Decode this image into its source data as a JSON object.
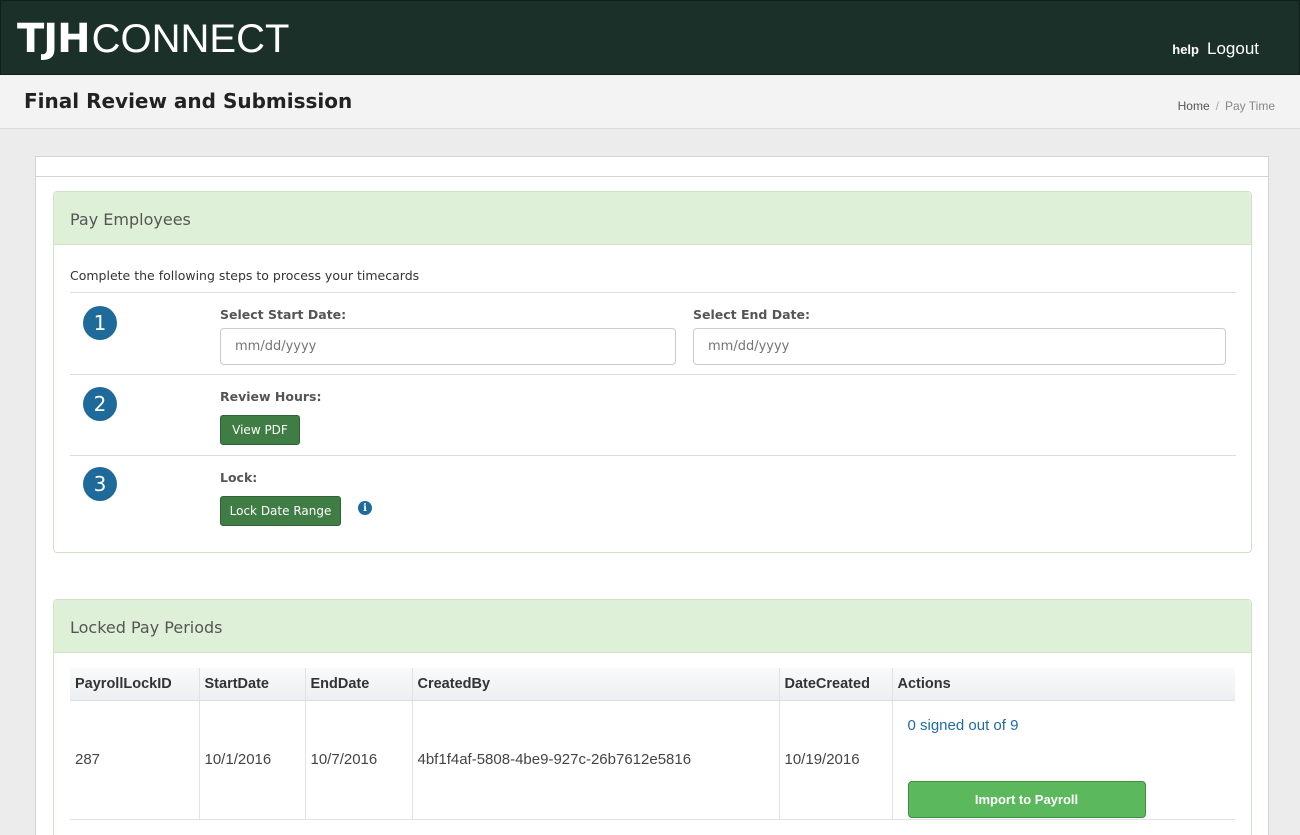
{
  "header": {
    "logo_bold": "TJH",
    "logo_light": "CONNECT",
    "help_label": "help",
    "logout_label": "Logout"
  },
  "page": {
    "title": "Final Review and Submission",
    "breadcrumb": [
      "Home",
      "Pay Time"
    ],
    "breadcrumb_separator": "/"
  },
  "pay_employees": {
    "title": "Pay Employees",
    "intro": "Complete the following steps to process your timecards",
    "steps": [
      {
        "number": "1",
        "start_label": "Select Start Date:",
        "start_placeholder": "mm/dd/yyyy",
        "end_label": "Select End Date:",
        "end_placeholder": "mm/dd/yyyy"
      },
      {
        "number": "2",
        "label": "Review Hours:",
        "button_label": "View PDF"
      },
      {
        "number": "3",
        "label": "Lock:",
        "button_label": "Lock Date Range",
        "info_icon": "info-circle-icon",
        "info_glyph": "i"
      }
    ]
  },
  "locked_pay_periods": {
    "title": "Locked Pay Periods",
    "columns": [
      "PayrollLockID",
      "StartDate",
      "EndDate",
      "CreatedBy",
      "DateCreated",
      "Actions"
    ],
    "rows": [
      {
        "PayrollLockID": "287",
        "StartDate": "10/1/2016",
        "EndDate": "10/7/2016",
        "CreatedBy": "4bf1f4af-5808-4be9-927c-26b7612e5816",
        "DateCreated": "10/19/2016",
        "signed_text": "0 signed out of 9",
        "import_label": "Import to Payroll"
      }
    ]
  },
  "colors": {
    "topbar": "#1a3028",
    "panel_heading": "#dff0d8",
    "dark_button": "#3f7d45",
    "import_button": "#5cb85c",
    "step_badge": "#1e6a9a",
    "link": "#1f6aa5"
  }
}
